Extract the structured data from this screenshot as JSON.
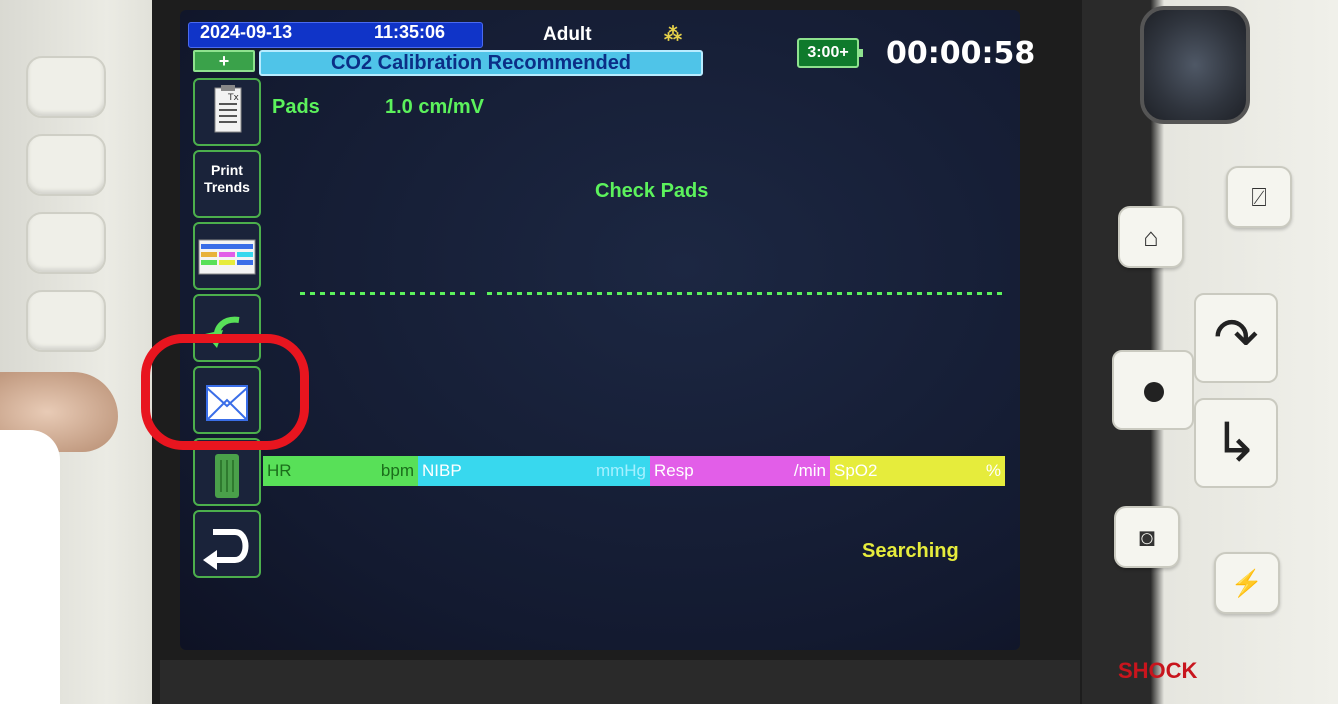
{
  "status_bar": {
    "date": "2024-09-13",
    "time": "11:35:06",
    "patient_type": "Adult",
    "plus_label": "+",
    "alert_message": "CO2 Calibration Recommended",
    "battery_label": "3:00+",
    "elapsed_time": "00:00:58"
  },
  "softkeys": {
    "print_trends_line1": "Print",
    "print_trends_line2": "Trends"
  },
  "ecg": {
    "lead": "Pads",
    "gain": "1.0 cm/mV",
    "message": "Check Pads"
  },
  "vitals": [
    {
      "name": "HR",
      "unit": "bpm",
      "color": "#58e058"
    },
    {
      "name": "NIBP",
      "unit": "mmHg",
      "color": "#38d8ee"
    },
    {
      "name": "Resp",
      "unit": "/min",
      "color": "#e25ee8"
    },
    {
      "name": "SpO2",
      "unit": "%",
      "color": "#e6ec3c"
    }
  ],
  "spo2_status": "Searching",
  "device": {
    "shock_label": "SHOCK"
  },
  "icons": [
    "treatment-summary-icon",
    "trend-table-icon",
    "back-arrow-icon",
    "event-envelope-icon",
    "trash-icon",
    "return-icon",
    "alarm-silence-icon",
    "home-display-icon",
    "nav-up-icon",
    "nav-down-icon",
    "select-icon",
    "snapshot-icon",
    "energy-icon"
  ]
}
